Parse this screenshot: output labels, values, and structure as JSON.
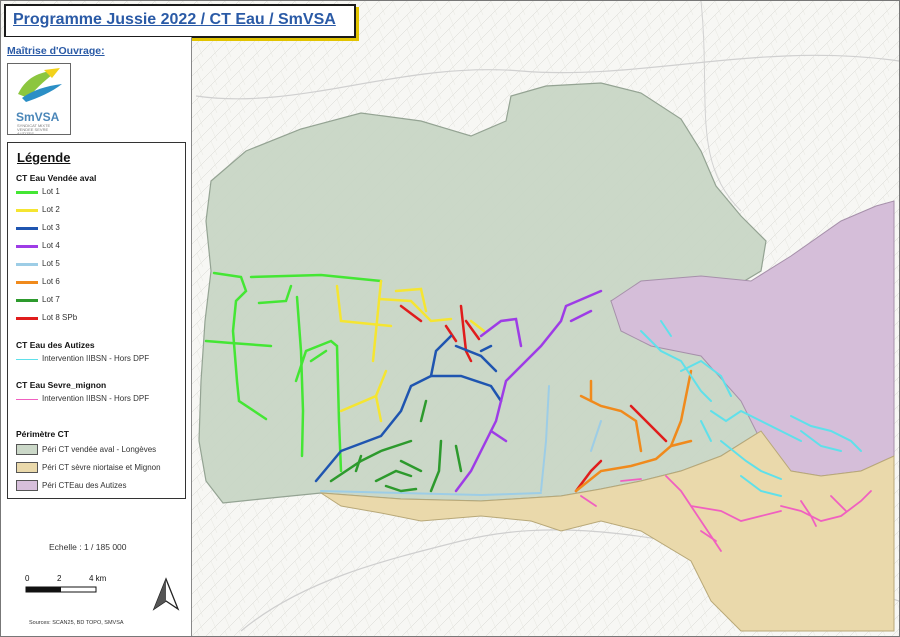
{
  "title": "Programme Jussie 2022 / CT Eau / SmVSA",
  "maitrise_label": "Maîtrise d'Ouvrage:",
  "logo": {
    "name": "SmVSA",
    "subtitle": "SYNDICAT MIXTE VENDEE SEVRE AUTIZES"
  },
  "legend": {
    "title": "Légende",
    "groups": [
      {
        "heading": "CT Eau Vendée aval",
        "items": [
          {
            "label": "Lot 1",
            "color": "#44e634"
          },
          {
            "label": "Lot 2",
            "color": "#f5e531"
          },
          {
            "label": "Lot 3",
            "color": "#1f55b0"
          },
          {
            "label": "Lot 4",
            "color": "#9e3ce6"
          },
          {
            "label": "Lot 5",
            "color": "#9dcde6"
          },
          {
            "label": "Lot 6",
            "color": "#f08a1c"
          },
          {
            "label": "Lot 7",
            "color": "#2d9a2d"
          },
          {
            "label": "Lot 8 SPb",
            "color": "#e01c1c"
          }
        ]
      },
      {
        "heading": "CT Eau des Autizes",
        "items": [
          {
            "label": "Intervention IIBSN - Hors DPF",
            "color": "#5fe0ea"
          }
        ]
      },
      {
        "heading": "CT Eau Sevre_mignon",
        "items": [
          {
            "label": "Intervention IIBSN - Hors DPF",
            "color": "#f060c0"
          }
        ]
      },
      {
        "heading": "Périmètre CT",
        "items": [
          {
            "label": "Péri CT vendée aval - Longèves",
            "color": "#cbd8c8"
          },
          {
            "label": "Péri CT sèvre niortaise et Mignon",
            "color": "#ead9ab"
          },
          {
            "label": "Péri CTEau des Autizes",
            "color": "#d7bfdb"
          }
        ]
      }
    ]
  },
  "scale": {
    "label": "Echelle : 1 / 185 000",
    "ticks": [
      "0",
      "2",
      "4 km"
    ]
  },
  "sources": "Sources: SCAN25, BD TOPO, SMVSA",
  "north_icon": "north-arrow-icon"
}
